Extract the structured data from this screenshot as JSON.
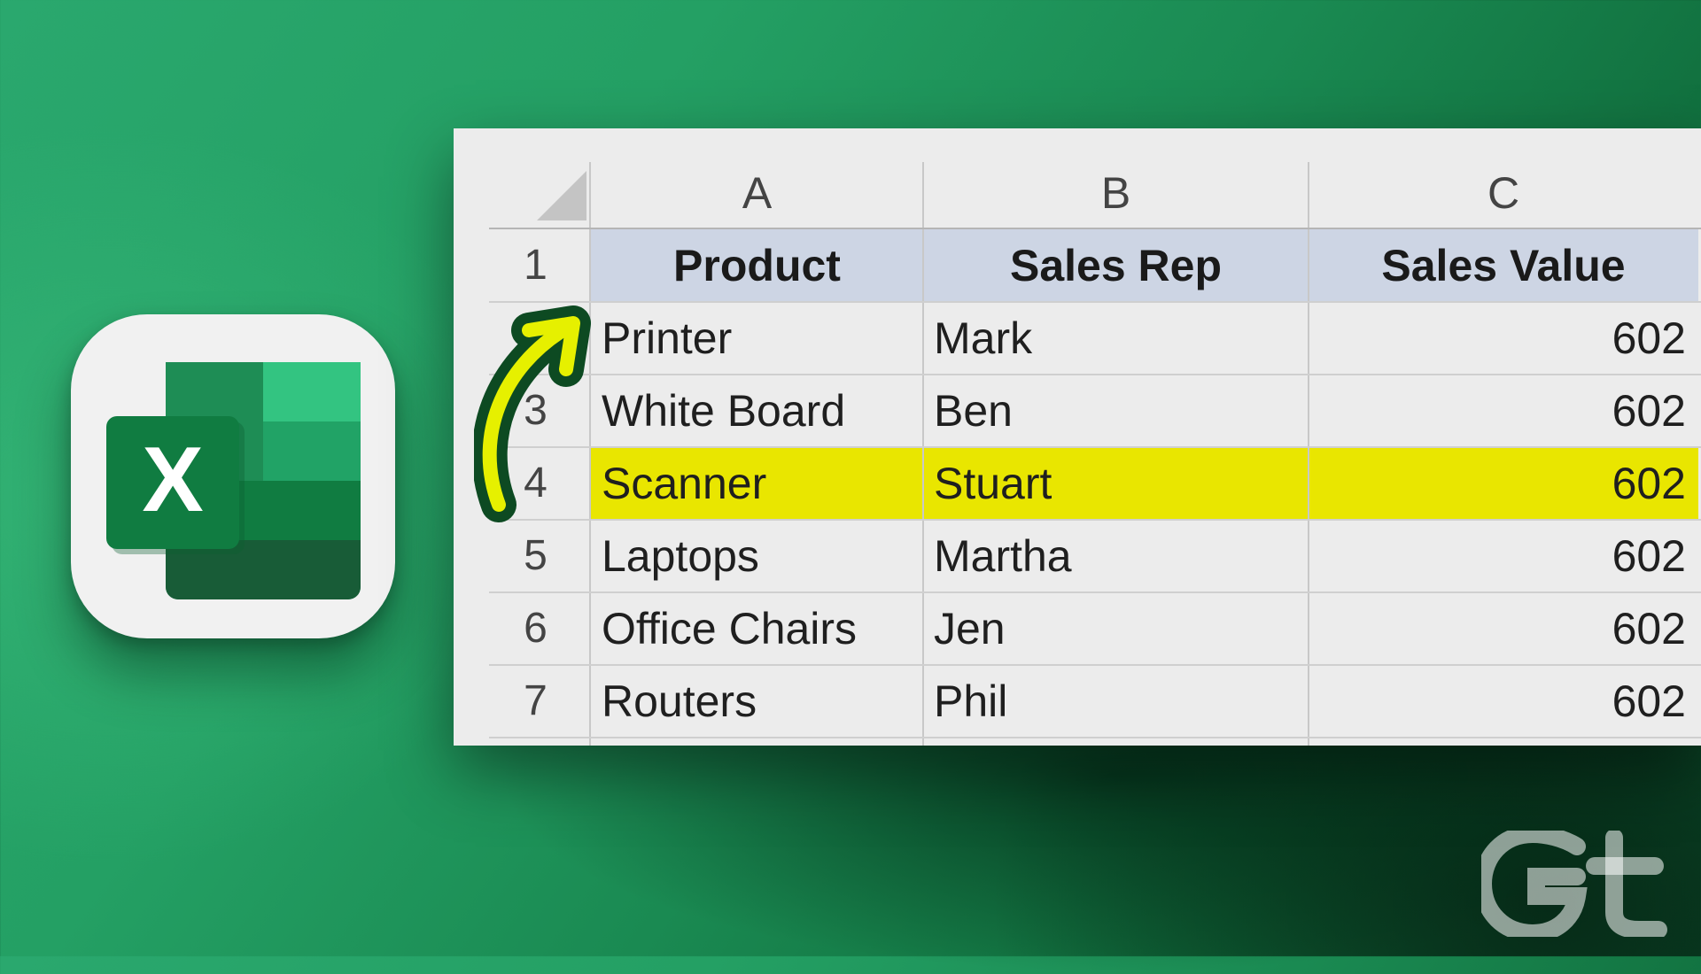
{
  "app_icon": {
    "letter": "X",
    "colors": {
      "dark": "#185c37",
      "mid": "#21a366",
      "light": "#33c481",
      "badge": "#107c41"
    }
  },
  "sheet": {
    "columns": [
      "A",
      "B",
      "C"
    ],
    "row_numbers": [
      "1",
      "2",
      "3",
      "4",
      "5",
      "6",
      "7"
    ],
    "header": {
      "product": "Product",
      "sales_rep": "Sales Rep",
      "sales_value": "Sales Value"
    },
    "rows": [
      {
        "product": "Printer",
        "rep": "Mark",
        "value": "602"
      },
      {
        "product": "White Board",
        "rep": "Ben",
        "value": "602"
      },
      {
        "product": "Scanner",
        "rep": "Stuart",
        "value": "602",
        "highlighted": true
      },
      {
        "product": "Laptops",
        "rep": "Martha",
        "value": "602"
      },
      {
        "product": "Office Chairs",
        "rep": "Jen",
        "value": "602"
      },
      {
        "product": "Routers",
        "rep": "Phil",
        "value": "602"
      }
    ],
    "colors": {
      "header_fill": "#cdd5e4",
      "highlight_fill": "#e9e600",
      "arrow": "#e6f000",
      "arrow_outline": "#0d4a22"
    }
  },
  "watermark": {
    "icon": "guiding-tech-logo"
  }
}
